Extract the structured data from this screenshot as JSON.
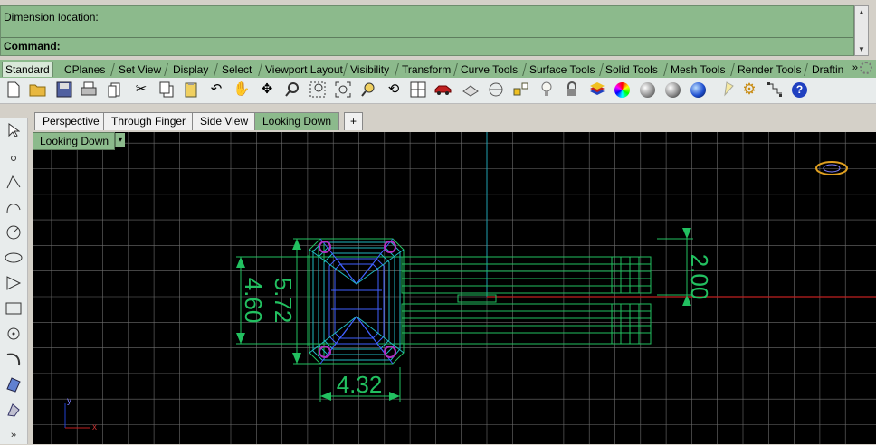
{
  "command": {
    "prompt_line": "Dimension location:",
    "command_label": "Command:",
    "value": ""
  },
  "toolbar_tabs": [
    "Standard",
    "CPlanes",
    "Set View",
    "Display",
    "Select",
    "Viewport Layout",
    "Visibility",
    "Transform",
    "Curve Tools",
    "Surface Tools",
    "Solid Tools",
    "Mesh Tools",
    "Render Tools",
    "Drafting"
  ],
  "active_tab": "Standard",
  "tab_overflow": "»",
  "toolbar_icons": [
    "new-icon",
    "open-icon",
    "save-icon",
    "print-icon",
    "import-icon",
    "cut-icon",
    "copy-icon",
    "paste-icon",
    "undo-icon",
    "pan-icon",
    "rotate-view-icon",
    "zoom-icon",
    "zoom-window-icon",
    "zoom-extents-icon",
    "zoom-selected-icon",
    "rotate-icon",
    "four-viewports-icon",
    "car-icon",
    "named-views-icon",
    "cplane-icon",
    "osnap-icon",
    "light-bulb-icon",
    "lock-icon",
    "layer-icon",
    "color-wheel-icon",
    "shade-icon",
    "rendered-icon",
    "render-icon",
    "spotlight-icon",
    "options-icon",
    "grid-snap-icon",
    "help-icon"
  ],
  "viewport_tabs": [
    "Perspective",
    "Through Finger",
    "Side View",
    "Looking Down"
  ],
  "active_viewport_tab": "Looking Down",
  "add_viewport_tab": "+",
  "viewport": {
    "title": "Looking Down",
    "dropdown_arrow": "▾",
    "background": "#000000",
    "grid_color": "#6e6e6e",
    "axis_x_color": "#c02020",
    "axis_y_color": "#20a0b0",
    "model_colors": {
      "green": "#22c060",
      "blue": "#4060ff",
      "cyan": "#20b8c0",
      "purple": "#b030c0"
    },
    "dimensions": [
      "4.60",
      "5.72",
      "4.32",
      "2.00"
    ],
    "axis_labels": {
      "x": "x",
      "y": "y"
    }
  },
  "left_toolbar_icons": [
    "select-arrow-icon",
    "point-icon",
    "polyline-icon",
    "curve-icon",
    "circle-icon",
    "ellipse-icon",
    "polygon-icon",
    "rectangle-icon",
    "circle-point-icon",
    "arc-icon",
    "surface-icon",
    "solid-icon"
  ],
  "left_more": "»"
}
